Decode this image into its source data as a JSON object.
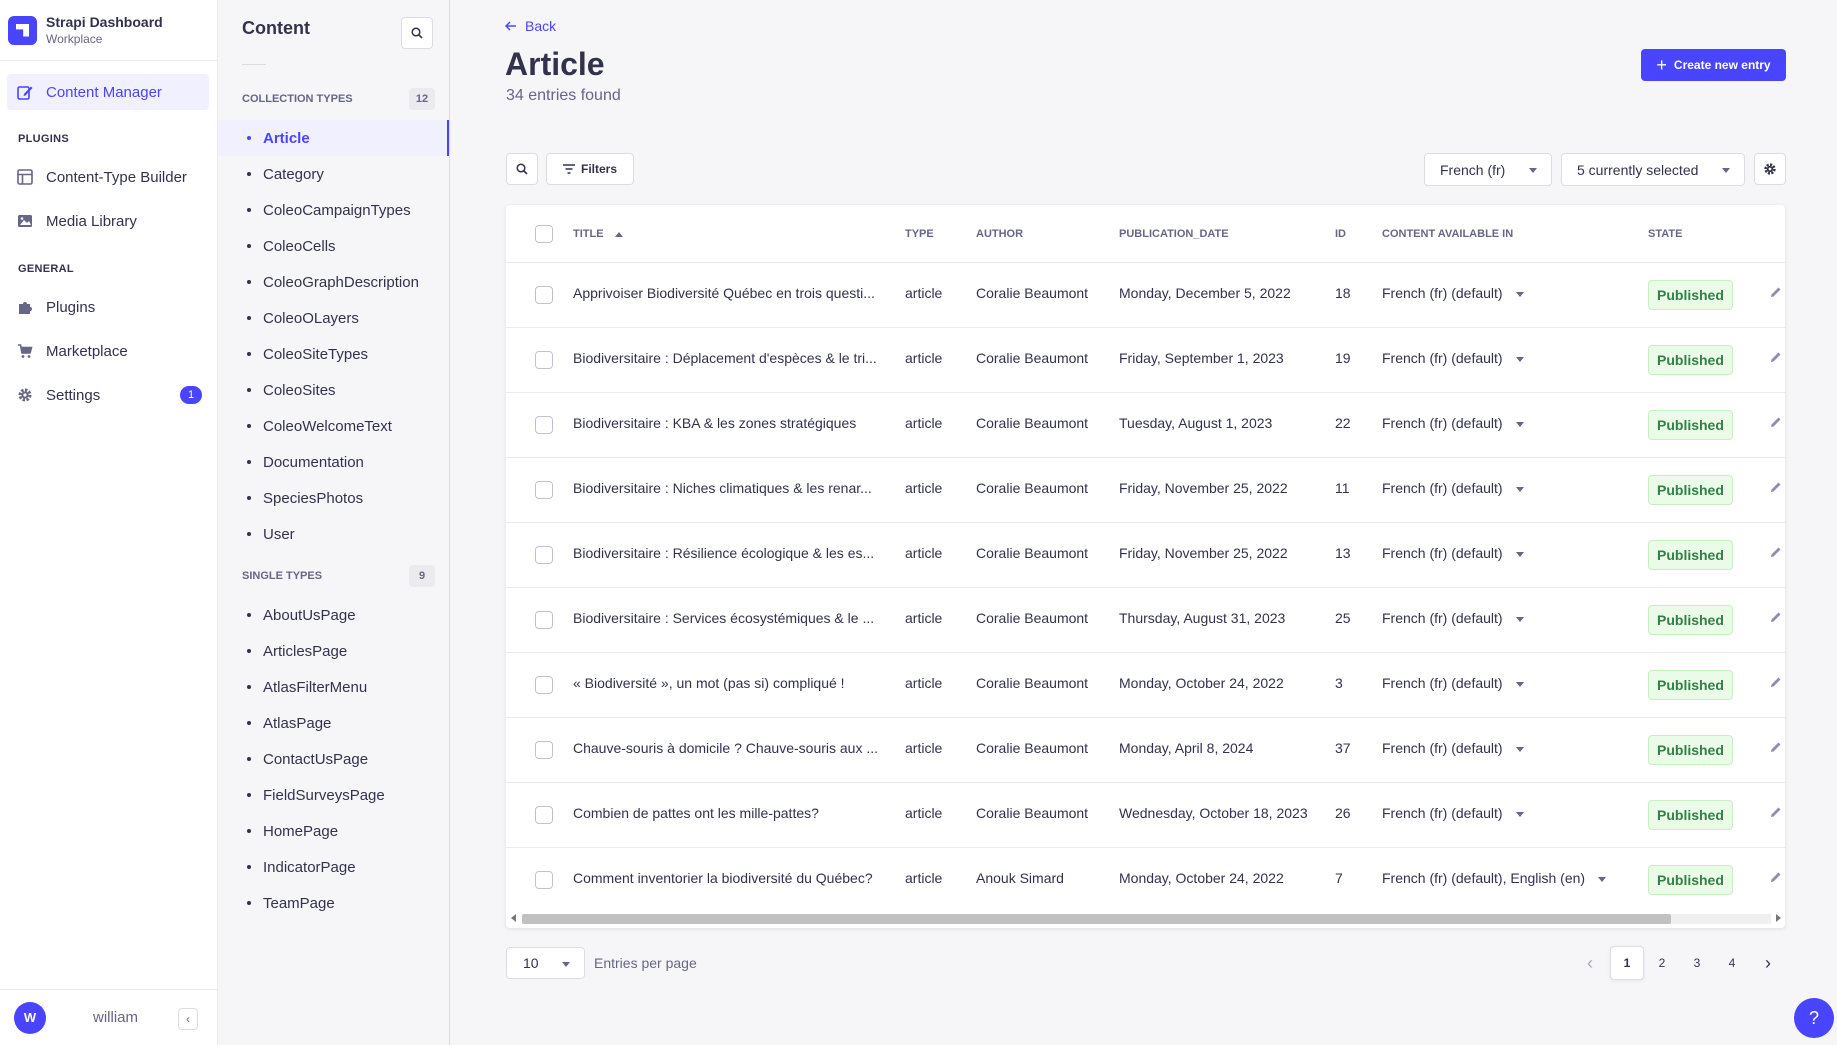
{
  "app": {
    "title": "Strapi Dashboard",
    "subtitle": "Workplace"
  },
  "mainnav": {
    "active_item": "Content Manager",
    "plugins_heading": "PLUGINS",
    "plugins": [
      "Content-Type Builder",
      "Media Library"
    ],
    "general_heading": "GENERAL",
    "general": [
      "Plugins",
      "Marketplace",
      "Settings"
    ],
    "settings_badge": "1",
    "user": {
      "initial": "W",
      "name": "william"
    }
  },
  "subnav": {
    "title": "Content",
    "collection_heading": "COLLECTION TYPES",
    "collection_count": "12",
    "collection_types": [
      "Article",
      "Category",
      "ColeoCampaignTypes",
      "ColeoCells",
      "ColeoGraphDescription",
      "ColeoOLayers",
      "ColeoSiteTypes",
      "ColeoSites",
      "ColeoWelcomeText",
      "Documentation",
      "SpeciesPhotos",
      "User"
    ],
    "single_heading": "SINGLE TYPES",
    "single_count": "9",
    "single_types": [
      "AboutUsPage",
      "ArticlesPage",
      "AtlasFilterMenu",
      "AtlasPage",
      "ContactUsPage",
      "FieldSurveysPage",
      "HomePage",
      "IndicatorPage",
      "TeamPage"
    ]
  },
  "header": {
    "back": "Back",
    "title": "Article",
    "subtitle": "34 entries found",
    "create_button": "Create new entry"
  },
  "toolbar": {
    "filters": "Filters",
    "locale": "French (fr)",
    "columns": "5 currently selected"
  },
  "table": {
    "columns": [
      "TITLE",
      "TYPE",
      "AUTHOR",
      "PUBLICATION_DATE",
      "ID",
      "CONTENT AVAILABLE IN",
      "STATE"
    ],
    "rows": [
      {
        "title": "Apprivoiser Biodiversité Québec en trois questi...",
        "type": "article",
        "author": "Coralie Beaumont",
        "date": "Monday, December 5, 2022",
        "id": "18",
        "locales": "French (fr) (default)",
        "state": "Published"
      },
      {
        "title": "Biodiversitaire : Déplacement d'espèces & le tri...",
        "type": "article",
        "author": "Coralie Beaumont",
        "date": "Friday, September 1, 2023",
        "id": "19",
        "locales": "French (fr) (default)",
        "state": "Published"
      },
      {
        "title": "Biodiversitaire : KBA & les zones stratégiques",
        "type": "article",
        "author": "Coralie Beaumont",
        "date": "Tuesday, August 1, 2023",
        "id": "22",
        "locales": "French (fr) (default)",
        "state": "Published"
      },
      {
        "title": "Biodiversitaire : Niches climatiques & les renar...",
        "type": "article",
        "author": "Coralie Beaumont",
        "date": "Friday, November 25, 2022",
        "id": "11",
        "locales": "French (fr) (default)",
        "state": "Published"
      },
      {
        "title": "Biodiversitaire : Résilience écologique & les es...",
        "type": "article",
        "author": "Coralie Beaumont",
        "date": "Friday, November 25, 2022",
        "id": "13",
        "locales": "French (fr) (default)",
        "state": "Published"
      },
      {
        "title": "Biodiversitaire : Services écosystémiques & le ...",
        "type": "article",
        "author": "Coralie Beaumont",
        "date": "Thursday, August 31, 2023",
        "id": "25",
        "locales": "French (fr) (default)",
        "state": "Published"
      },
      {
        "title": "« Biodiversité », un mot (pas si) compliqué !",
        "type": "article",
        "author": "Coralie Beaumont",
        "date": "Monday, October 24, 2022",
        "id": "3",
        "locales": "French (fr) (default)",
        "state": "Published"
      },
      {
        "title": "Chauve-souris à domicile ? Chauve-souris aux ...",
        "type": "article",
        "author": "Coralie Beaumont",
        "date": "Monday, April 8, 2024",
        "id": "37",
        "locales": "French (fr) (default)",
        "state": "Published"
      },
      {
        "title": "Combien de pattes ont les mille-pattes?",
        "type": "article",
        "author": "Coralie Beaumont",
        "date": "Wednesday, October 18, 2023",
        "id": "26",
        "locales": "French (fr) (default)",
        "state": "Published"
      },
      {
        "title": "Comment inventorier la biodiversité du Québec?",
        "type": "article",
        "author": "Anouk Simard",
        "date": "Monday, October 24, 2022",
        "id": "7",
        "locales": "French (fr) (default), English (en)",
        "state": "Published"
      }
    ]
  },
  "pagination": {
    "per_page": "10",
    "per_page_label": "Entries per page",
    "pages": [
      "1",
      "2",
      "3",
      "4"
    ],
    "current": "1"
  },
  "colors": {
    "primary": "#4945ff",
    "success_text": "#328048",
    "success_bg": "#eafbe7"
  }
}
